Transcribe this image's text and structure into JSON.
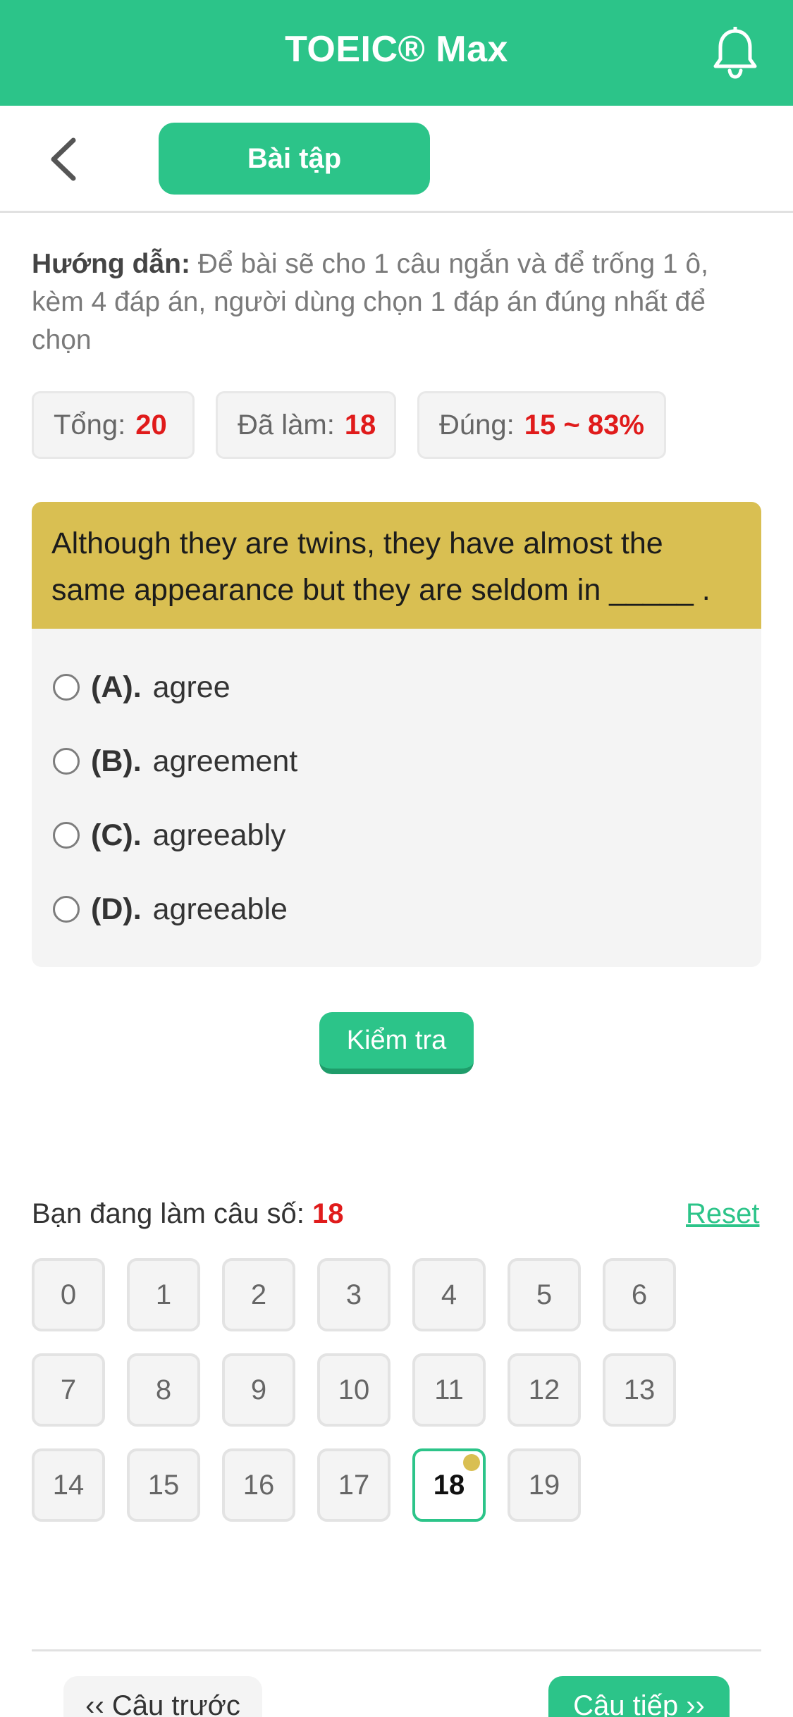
{
  "header": {
    "title": "TOEIC® Max",
    "icon": "bell-icon"
  },
  "subheader": {
    "back_icon": "chevron-left-icon",
    "tab_label": "Bài tập"
  },
  "instruction": {
    "label": "Hướng dẫn:",
    "text": "Để bài sẽ cho 1 câu ngắn và để trống 1 ô, kèm 4 đáp án, người dùng chọn 1 đáp án đúng nhất để chọn"
  },
  "stats": [
    {
      "label": "Tổng:",
      "value": "20"
    },
    {
      "label": "Đã làm:",
      "value": "18"
    },
    {
      "label": "Đúng:",
      "value": "15 ~ 83%"
    }
  ],
  "question": {
    "text": "Although they are twins, they have almost the same appearance but they are seldom in _____ .",
    "options": [
      {
        "letter": "(A).",
        "text": "agree"
      },
      {
        "letter": "(B).",
        "text": "agreement"
      },
      {
        "letter": "(C).",
        "text": "agreeably"
      },
      {
        "letter": "(D).",
        "text": "agreeable"
      }
    ]
  },
  "check_label": "Kiểm tra",
  "progress": {
    "label": "Bạn đang làm câu số:",
    "current": "18",
    "reset_label": "Reset",
    "numbers": [
      "0",
      "1",
      "2",
      "3",
      "4",
      "5",
      "6",
      "7",
      "8",
      "9",
      "10",
      "11",
      "12",
      "13",
      "14",
      "15",
      "16",
      "17",
      "18",
      "19"
    ]
  },
  "nav": {
    "prev_label": "‹‹ Câu trước",
    "next_label": "Câu tiếp ››"
  },
  "colors": {
    "primary": "#2cc489",
    "question_bg": "#d9bf52",
    "highlight_text": "#e01b1b"
  }
}
